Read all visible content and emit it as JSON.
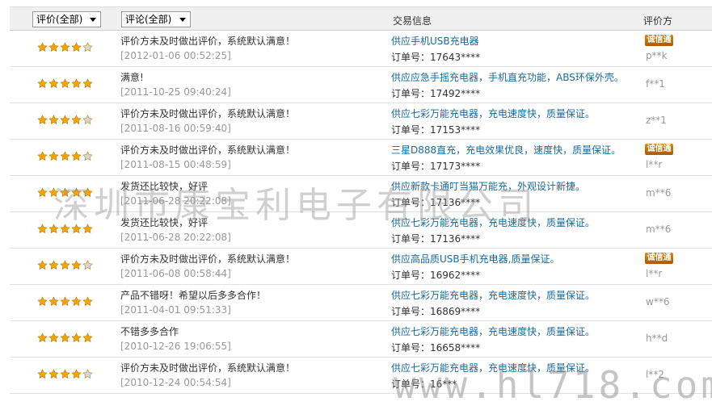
{
  "header": {
    "rating_filter": "评价(全部)",
    "comment_filter": "评论(全部)",
    "trade_info": "交易信息",
    "rater": "评价方"
  },
  "colors": {
    "star_full": "#f5a300",
    "star_empty": "#d6d6d6",
    "link": "#1a6b9a",
    "badge": "#c07010"
  },
  "rows": [
    {
      "stars": 4,
      "comment": "评价方未及时做出评价，系统默认满意！",
      "date": "[2012-01-06 00:52:25]",
      "product": "供应手机USB充电器",
      "order": "订单号：17643****",
      "badge": "诚信通",
      "rater": "p**k"
    },
    {
      "stars": 5,
      "comment": "满意!",
      "date": "[2011-10-25 09:40:24]",
      "product": "供应应急手摇充电器，手机直充功能，ABS环保外壳。",
      "order": "订单号：17492****",
      "badge": "",
      "rater": "f**1"
    },
    {
      "stars": 4,
      "comment": "评价方未及时做出评价，系统默认满意！",
      "date": "[2011-08-16 00:59:40]",
      "product": "供应七彩万能充电器，充电速度快，质量保证。",
      "order": "订单号：17153****",
      "badge": "",
      "rater": "z**1"
    },
    {
      "stars": 4,
      "comment": "评价方未及时做出评价，系统默认满意！",
      "date": "[2011-08-15 00:48:59]",
      "product": "三星D888直充，充电效果优良，速度快，质量保证。",
      "order": "订单号：17173****",
      "badge": "诚信通",
      "rater": "l**r"
    },
    {
      "stars": 5,
      "comment": "发货还比较快，好评",
      "date": "[2011-06-28 20:22:08]",
      "product": "供应新款卡通叮当猫万能充，外观设计新捷。",
      "order": "订单号：17136****",
      "badge": "",
      "rater": "m**6"
    },
    {
      "stars": 5,
      "comment": "发货还比较快，好评",
      "date": "[2011-06-28 20:22:08]",
      "product": "供应七彩万能充电器，充电速度快，质量保证。",
      "order": "订单号：17136****",
      "badge": "",
      "rater": "m**6"
    },
    {
      "stars": 4,
      "comment": "评价方未及时做出评价，系统默认满意！",
      "date": "[2011-06-08 00:58:44]",
      "product": "供应高品质USB手机充电器,质量保证。",
      "order": "订单号：16962****",
      "badge": "诚信通",
      "rater": "l**r"
    },
    {
      "stars": 5,
      "comment": "产品不错呀！希望以后多多合作！",
      "date": "[2011-04-01 09:51:33]",
      "product": "供应七彩万能充电器，充电速度快，质量保证。",
      "order": "订单号：16869****",
      "badge": "",
      "rater": "w**6"
    },
    {
      "stars": 5,
      "comment": "不错多多合作",
      "date": "[2010-12-26 19:06:55]",
      "product": "供应七彩万能充电器，充电速度快，质量保证。",
      "order": "订单号：16658****",
      "badge": "",
      "rater": "h**d"
    },
    {
      "stars": 4,
      "comment": "评价方未及时做出评价，系统默认满意！",
      "date": "[2010-12-24 00:54:54]",
      "product": "供应七彩万能充电器，充电速度快，质量保证。",
      "order": "订单号：16***",
      "badge": "",
      "rater": "l**2"
    }
  ],
  "watermark": {
    "company": "深圳市康宝利电子有限公司",
    "url": "www.hl718.com"
  }
}
